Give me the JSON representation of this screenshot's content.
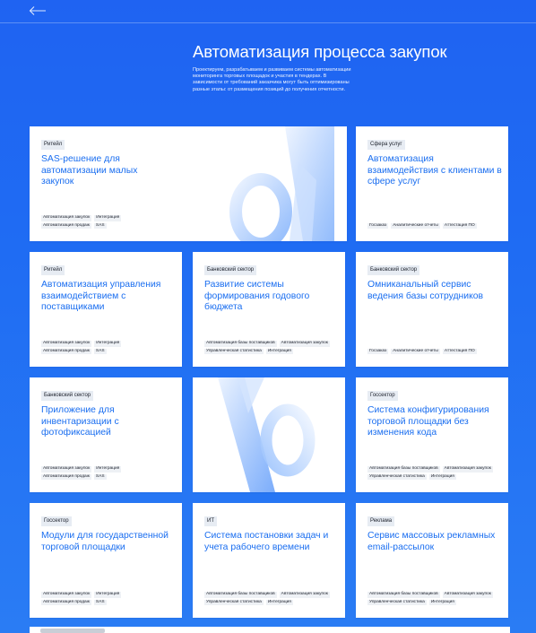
{
  "header": {
    "back_icon": "arrow-left-icon",
    "title": "Автоматизация процесса закупок",
    "description": "Проектируем, разрабатываем и развиваем системы автоматизации мониторинга торговых площадок и участия в тендерах. В зависимости от требований заказчика могут быть оптимизированы разные этапы: от размещения позиций до получения отчетности."
  },
  "cards": [
    {
      "category": "Ритейл",
      "title": "SAS-решение для автоматизации малых закупок",
      "tags": [
        [
          "Автоматизация закупок",
          "Интеграция"
        ],
        [
          "Автоматизация продаж",
          "SAS"
        ]
      ]
    },
    {
      "category": "Сфера услуг",
      "title": "Автоматизация взаимодействия с клиентами в сфере услуг",
      "tags": [
        [
          "Госзаказ",
          "Аналитические отчеты",
          "Аттестация ПО"
        ]
      ]
    },
    {
      "category": "Ритейл",
      "title": "Автоматизация управления взаимодействием с поставщиками",
      "tags": [
        [
          "Автоматизация закупок",
          "Интеграция"
        ],
        [
          "Автоматизация продаж",
          "SAS"
        ]
      ]
    },
    {
      "category": "Банковский сектор",
      "title": "Развитие системы формирования годового бюджета",
      "tags": [
        [
          "Автоматизация базы поставщиков",
          "Автоматизация закупок"
        ],
        [
          "Управленческая статистика",
          "Интеграция"
        ]
      ]
    },
    {
      "category": "Банковский сектор",
      "title": "Омниканальный сервис ведения базы сотрудников",
      "tags": [
        [
          "Госзаказ",
          "Аналитические отчеты",
          "Аттестация ПО"
        ]
      ]
    },
    {
      "category": "Банковский сектор",
      "title": "Приложение для инвентаризации с фотофиксацией",
      "tags": [
        [
          "Автоматизация закупок",
          "Интеграция"
        ],
        [
          "Автоматизация продаж",
          "SAS"
        ]
      ]
    },
    {
      "category": "Госсектор",
      "title": "Система конфигурирования торговой площадки без изменения кода",
      "tags": [
        [
          "Автоматизация базы поставщиков",
          "Автоматизация закупок"
        ],
        [
          "Управленческая статистика",
          "Интеграция"
        ]
      ]
    },
    {
      "category": "Госсектор",
      "title": "Модули для государственной торговой площадки",
      "tags": [
        [
          "Автоматизация закупок",
          "Интеграция"
        ],
        [
          "Автоматизация продаж",
          "SAS"
        ]
      ]
    },
    {
      "category": "ИТ",
      "title": "Система постановки задач и учета рабочего времени",
      "tags": [
        [
          "Автоматизация базы поставщиков",
          "Автоматизация закупок"
        ],
        [
          "Управленческая статистика",
          "Интеграция"
        ]
      ]
    },
    {
      "category": "Реклама",
      "title": "Сервис массовых рекламных email-рассылок",
      "tags": [
        [
          "Автоматизация базы поставщиков",
          "Автоматизация закупок"
        ],
        [
          "Управленческая статистика",
          "Интеграция"
        ]
      ]
    }
  ],
  "colors": {
    "background": "#1f63f2",
    "accent_title": "#1a6ef0",
    "card": "#ffffff"
  }
}
